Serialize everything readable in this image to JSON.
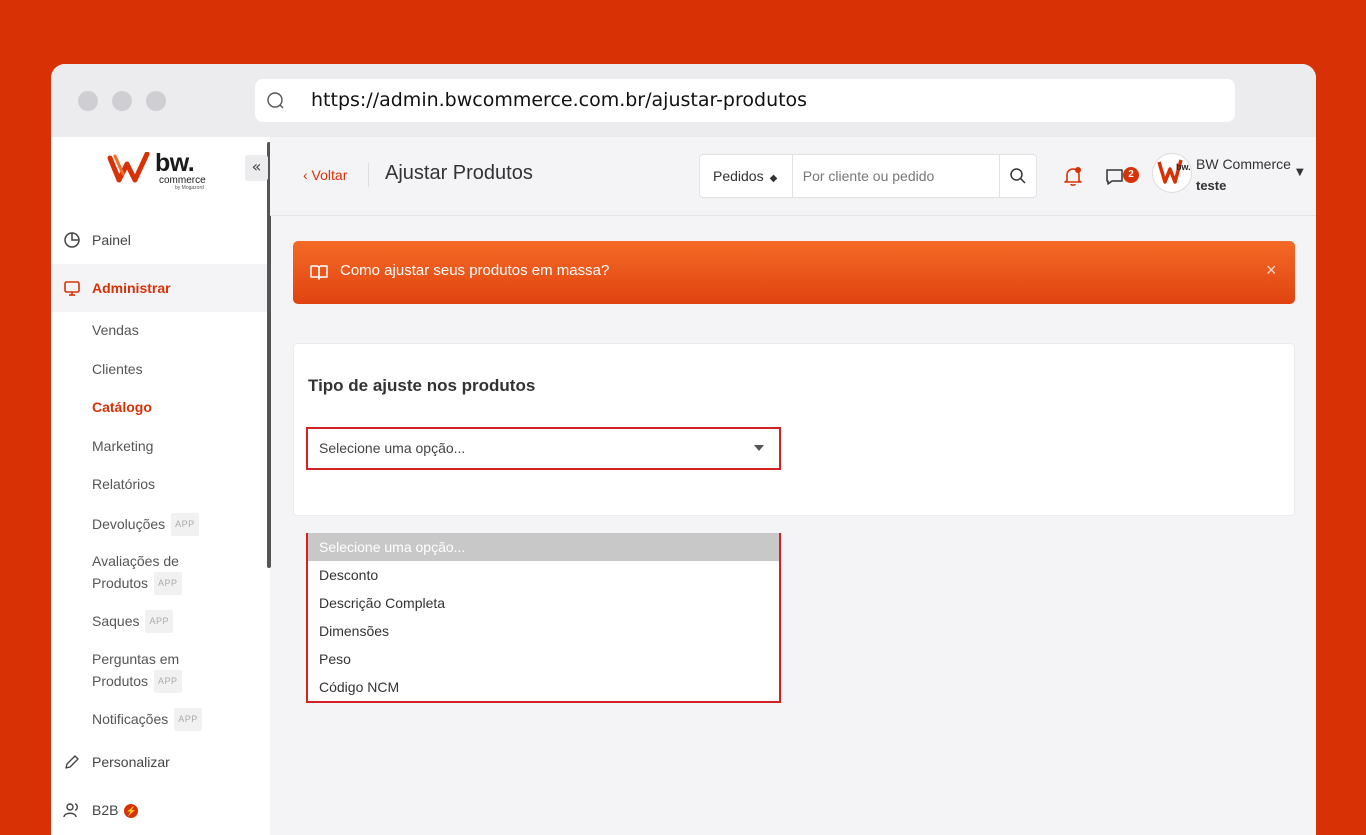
{
  "browser": {
    "url": "https://admin.bwcommerce.com.br/ajustar-produtos"
  },
  "logo": {
    "main": "bw.",
    "sub": "commerce",
    "by": "by Mogazord"
  },
  "sidebar": {
    "collapse": "«",
    "app_badge": "APP",
    "painel": "Painel",
    "administrar": "Administrar",
    "vendas": "Vendas",
    "clientes": "Clientes",
    "catalogo": "Catálogo",
    "marketing": "Marketing",
    "relatorios": "Relatórios",
    "devolucoes": "Devoluções",
    "avaliacoes_1": "Avaliações de",
    "avaliacoes_2": "Produtos",
    "saques": "Saques",
    "perguntas_1": "Perguntas em",
    "perguntas_2": "Produtos",
    "notificacoes": "Notificações",
    "personalizar": "Personalizar",
    "b2b": "B2B"
  },
  "topbar": {
    "back": "‹ Voltar",
    "title": "Ajustar Produtos",
    "search_type": "Pedidos",
    "search_placeholder": "Por cliente ou pedido",
    "chat_count": "2",
    "user_name": "BW Commerce",
    "user_store": "teste"
  },
  "banner": {
    "text": "Como ajustar seus produtos em massa?",
    "close": "×"
  },
  "card": {
    "title": "Tipo de ajuste nos produtos",
    "selected": "Selecione uma opção...",
    "options": [
      "Selecione uma opção...",
      "Desconto",
      "Descrição Completa",
      "Dimensões",
      "Peso",
      "Código NCM"
    ]
  },
  "colors": {
    "accent": "#d83106",
    "banner_gradient_top": "#f46a26",
    "banner_gradient_bottom": "#e04310",
    "focus_border": "#d32222"
  }
}
